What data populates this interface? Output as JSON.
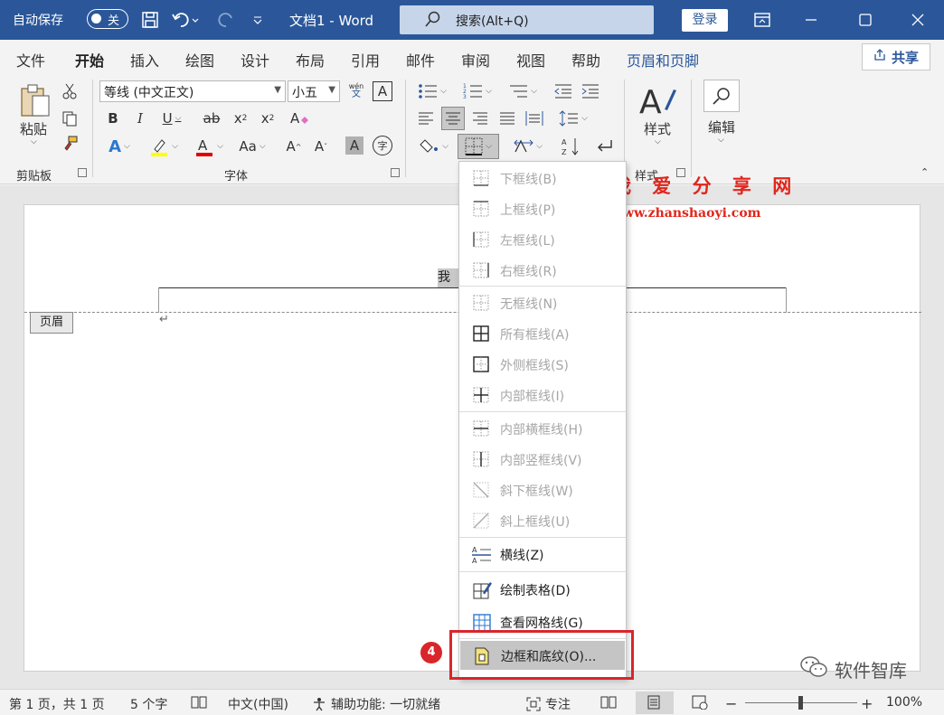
{
  "titlebar": {
    "autosave_label": "自动保存",
    "autosave_state": "关",
    "doc_title": "文档1 - Word",
    "search_placeholder": "搜索(Alt+Q)",
    "login_label": "登录"
  },
  "tabs": {
    "file": "文件",
    "home": "开始",
    "insert": "插入",
    "draw": "绘图",
    "design": "设计",
    "layout": "布局",
    "references": "引用",
    "mailings": "邮件",
    "review": "审阅",
    "view": "视图",
    "help": "帮助",
    "header_footer": "页眉和页脚",
    "share": "共享"
  },
  "ribbon": {
    "paste": "粘贴",
    "clipboard": "剪贴板",
    "font_name": "等线 (中文正文)",
    "font_size": "小五",
    "font_group": "字体",
    "style_btn": "样式",
    "style_group": "样式",
    "edit_btn": "编辑",
    "wen_top": "wén",
    "wen_bottom": "文"
  },
  "document": {
    "header_tag": "页眉",
    "selected_text": "我爱",
    "watermark_title": "我 爱 分 享 网",
    "watermark_url": "www.zhanshaoyi.com",
    "brand": "软件智库"
  },
  "dropdown": {
    "items": [
      {
        "label": "下框线(B)",
        "icon": "bottom-border-icon"
      },
      {
        "label": "上框线(P)",
        "icon": "top-border-icon"
      },
      {
        "label": "左框线(L)",
        "icon": "left-border-icon"
      },
      {
        "label": "右框线(R)",
        "icon": "right-border-icon"
      },
      {
        "label": "无框线(N)",
        "icon": "no-border-icon"
      },
      {
        "label": "所有框线(A)",
        "icon": "all-borders-icon"
      },
      {
        "label": "外侧框线(S)",
        "icon": "outside-borders-icon"
      },
      {
        "label": "内部框线(I)",
        "icon": "inside-borders-icon"
      },
      {
        "label": "内部横框线(H)",
        "icon": "inside-horizontal-border-icon"
      },
      {
        "label": "内部竖框线(V)",
        "icon": "inside-vertical-border-icon"
      },
      {
        "label": "斜下框线(W)",
        "icon": "diagonal-down-border-icon"
      },
      {
        "label": "斜上框线(U)",
        "icon": "diagonal-up-border-icon"
      },
      {
        "label": "横线(Z)",
        "icon": "horizontal-line-icon"
      },
      {
        "label": "绘制表格(D)",
        "icon": "draw-table-icon"
      },
      {
        "label": "查看网格线(G)",
        "icon": "view-gridlines-icon"
      },
      {
        "label": "边框和底纹(O)...",
        "icon": "borders-shading-icon"
      }
    ]
  },
  "callout": {
    "number": "4"
  },
  "statusbar": {
    "page": "第 1 页，共 1 页",
    "words": "5 个字",
    "language": "中文(中国)",
    "accessibility": "辅助功能: 一切就绪",
    "focus": "专注",
    "zoom": "100%",
    "zoom_minus": "−",
    "zoom_plus": "+"
  }
}
